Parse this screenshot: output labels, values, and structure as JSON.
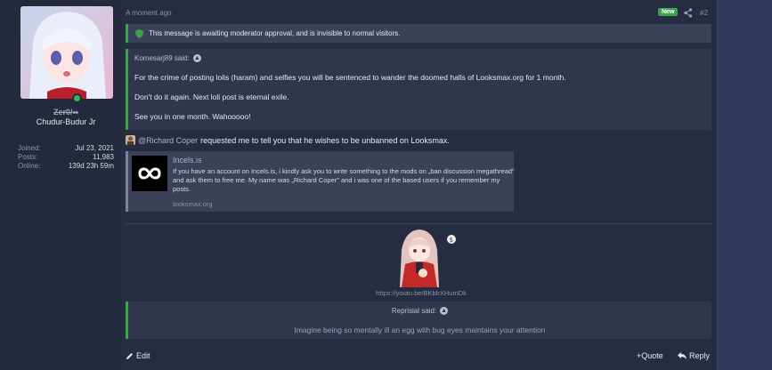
{
  "user": {
    "title": "Zer0/∞",
    "name": "Chudur-Budur Jr",
    "stats": [
      {
        "label": "Joined:",
        "value": "Jul 23, 2021"
      },
      {
        "label": "Posts:",
        "value": "11,983"
      },
      {
        "label": "Online:",
        "value": "139d 23h 59m"
      }
    ]
  },
  "header": {
    "timestamp": "A moment ago",
    "badge": "New",
    "post_number": "#2"
  },
  "moderation_notice": "This message is awaiting moderator approval, and is invisible to normal visitors.",
  "quote1": {
    "author": "Komesarj89 said:",
    "lines": [
      "For the crime of posting lolis (haram) and selfies you will be sentenced to wander the doomed halls of Looksmax.org for 1 month.",
      "Don't do it again. Next loli post is eternal exile.",
      "See you in one month. Wahooooo!"
    ]
  },
  "message": {
    "mention": "@Richard Coper",
    "text": " requested me to tell you that he wishes to be unbanned on Looksmax."
  },
  "unfurl": {
    "title": "Incels.is",
    "text": "If you have an account on Incels.is, i kindly ask you to write something to the mods on „ban discussion megathread\" and ask them to free me. My name was „Richard Coper\" and i was one of the based users if you remember my posts.",
    "domain": "looksmax.org"
  },
  "video_link": "https://youtu.be/BKblrXHumDk",
  "quote2": {
    "author": "Reprisial said:",
    "text": "Imagine being so mentally ill an egg with bug eyes maintains your attention"
  },
  "footer": {
    "edit": "Edit",
    "quote": "+Quote",
    "reply": "Reply"
  },
  "colors": {
    "accent_green": "#3fa34d",
    "background": "#262d42"
  }
}
